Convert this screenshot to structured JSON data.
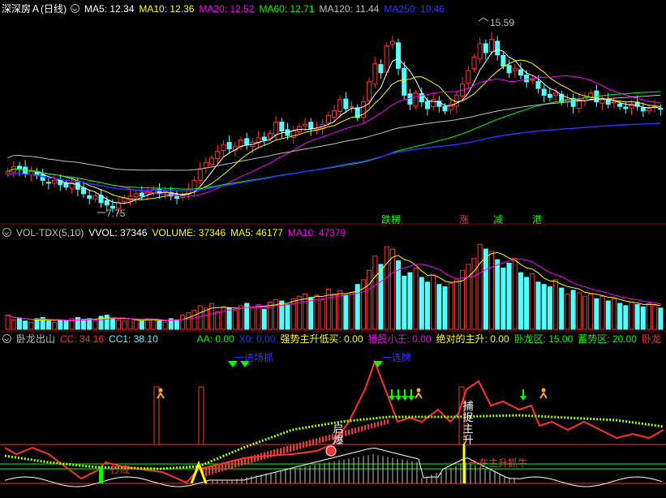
{
  "price_header": {
    "name": "深深房Ａ(日线)",
    "ma5": "MA5: 12.34",
    "ma10": "MA10: 12.36",
    "ma20": "MA20: 12.52",
    "ma60": "MA60: 12.71",
    "ma120": "MA120: 11.44",
    "ma250": "MA250: 10.46"
  },
  "price_labels": {
    "high": "15.59",
    "low": "7.75"
  },
  "signals": {
    "s1": "跌楞",
    "s2": "涨",
    "s3": "减",
    "s4": "港"
  },
  "vol_header": {
    "name": "VOL-TDX(5,10)",
    "vvol": "VVOL: 37346",
    "volume": "VOLUME: 37346",
    "ma5": "MA5: 46177",
    "ma10": "MA10: 47379"
  },
  "ind_header": {
    "name": "卧龙出山",
    "cc": "CC: 34.16",
    "cc1": "CC1: 38.10",
    "aa": "AA: 0.00",
    "x0": "X0: 0.00",
    "qs": "强势主升低买: 0.00",
    "lg": "猎股小王: 0.00",
    "jd": "绝对的主升: 0.00",
    "wl": "卧龙区: 15.00",
    "xs": "蓄势区: 20.00",
    "wl2": "卧龙"
  },
  "ind_labels": {
    "a": "一进场抓",
    "b": "一选牌",
    "c": "启爆",
    "d": "捕捉主升",
    "e": "一在主升抓牛",
    "f": "抄底"
  },
  "colors": {
    "up": "#ff3232",
    "down": "#54ffff",
    "ma5": "#ffffff",
    "ma10": "#ffff00",
    "ma20": "#ff00ff",
    "ma60": "#00ff00",
    "ma120": "#c0c0c0",
    "ma250": "#3030ff"
  },
  "chart_data": {
    "type": "candlestick",
    "ylim": [
      7.2,
      16.4
    ],
    "close": [
      9.4,
      9.6,
      9.5,
      9.3,
      9.4,
      9.2,
      9.0,
      8.9,
      9.0,
      8.8,
      8.7,
      8.9,
      8.6,
      8.4,
      8.2,
      8.3,
      8.0,
      7.9,
      7.75,
      8.0,
      8.2,
      8.3,
      8.4,
      8.3,
      8.5,
      8.6,
      8.4,
      8.5,
      8.3,
      8.2,
      8.3,
      8.6,
      9.0,
      9.5,
      9.8,
      10.0,
      10.3,
      10.6,
      10.4,
      10.5,
      10.8,
      10.6,
      10.7,
      10.9,
      10.8,
      11.1,
      11.6,
      11.2,
      11.0,
      11.2,
      11.4,
      11.5,
      11.3,
      11.3,
      11.5,
      11.9,
      12.1,
      12.6,
      12.2,
      12.3,
      11.8,
      12.5,
      13.4,
      14.2,
      13.8,
      15.0,
      15.2,
      14.0,
      12.8,
      12.4,
      12.9,
      12.5,
      12.2,
      12.6,
      12.3,
      12.1,
      12.4,
      12.8,
      13.3,
      13.9,
      14.5,
      15.1,
      14.7,
      15.3,
      14.6,
      14.1,
      13.8,
      14.0,
      13.7,
      13.4,
      13.5,
      13.1,
      12.8,
      12.7,
      12.9,
      12.5,
      12.6,
      12.3,
      12.6,
      12.7,
      12.9,
      12.5,
      12.6,
      12.4,
      12.5,
      12.3,
      12.2,
      12.4,
      12.3,
      12.1,
      12.2,
      12.3,
      12.2
    ],
    "volume": [
      12,
      8,
      9,
      7,
      6,
      9,
      10,
      7,
      6,
      8,
      7,
      9,
      10,
      8,
      9,
      7,
      11,
      12,
      9,
      8,
      7,
      9,
      8,
      7,
      9,
      8,
      7,
      6,
      9,
      8,
      12,
      14,
      16,
      20,
      18,
      22,
      15,
      19,
      18,
      16,
      20,
      22,
      18,
      21,
      17,
      23,
      25,
      24,
      21,
      26,
      28,
      30,
      27,
      29,
      25,
      34,
      30,
      33,
      29,
      31,
      38,
      42,
      50,
      62,
      55,
      70,
      68,
      58,
      45,
      48,
      52,
      44,
      40,
      46,
      38,
      36,
      39,
      42,
      50,
      55,
      60,
      72,
      68,
      66,
      59,
      52,
      56,
      60,
      48,
      44,
      47,
      40,
      38,
      36,
      42,
      35,
      30,
      33,
      31,
      28,
      30,
      26,
      28,
      24,
      26,
      22,
      20,
      23,
      21,
      19,
      22,
      20,
      18
    ]
  }
}
